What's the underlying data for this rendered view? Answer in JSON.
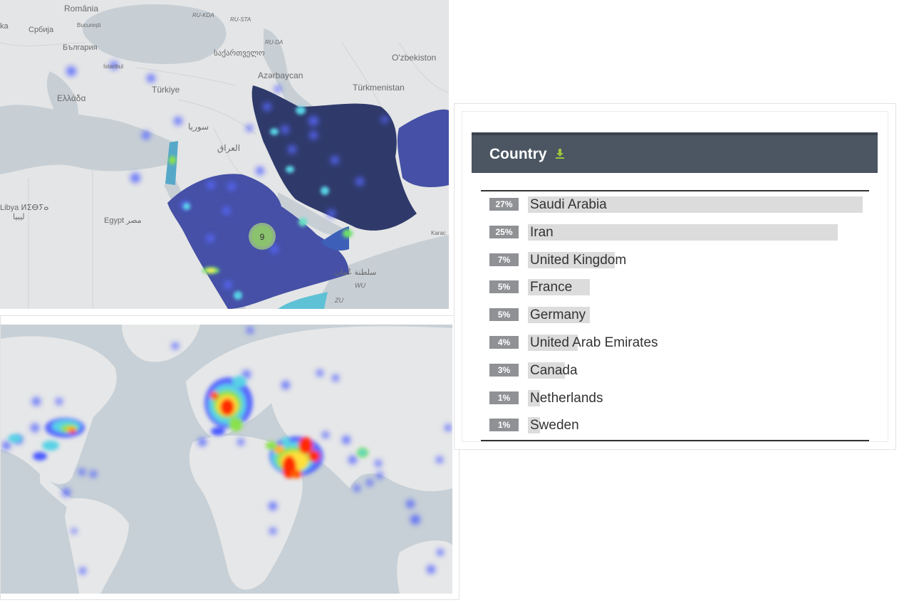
{
  "top_map": {
    "labels": {
      "romania": "România",
      "serbia": "Србија",
      "bucharest": "București",
      "bulgaria": "България",
      "istanbul": "İstanbul",
      "turkey": "Türkiye",
      "greece": "Ελλάδα",
      "georgia": "საქართველო",
      "azerbaijan": "Azərbaycan",
      "uzbekistan": "O'zbekiston",
      "turkmenistan": "Türkmenistan",
      "syria": "سوريا",
      "iraq": "العراق",
      "egypt": "Egypt مصر",
      "libya": "Libya ⵍⵉⴱⵢⴰ",
      "libya_ar": "ليبيا",
      "oman": "سلطنة عُمان",
      "ru_kda": "RU-KDA",
      "ru_sta": "RU-STA",
      "ru_da": "RU-DA",
      "wu": "WU",
      "zu": "ZU",
      "karachi": "Karac",
      "ka": "ka"
    },
    "cluster_count": "9"
  },
  "country_panel": {
    "title": "Country",
    "rows": [
      {
        "percent": "27%",
        "name": "Saudi Arabia",
        "share": 27
      },
      {
        "percent": "25%",
        "name": "Iran",
        "share": 25
      },
      {
        "percent": "7%",
        "name": "United Kingdom",
        "share": 7
      },
      {
        "percent": "5%",
        "name": "France",
        "share": 5
      },
      {
        "percent": "5%",
        "name": "Germany",
        "share": 5
      },
      {
        "percent": "4%",
        "name": "United Arab Emirates",
        "share": 4
      },
      {
        "percent": "3%",
        "name": "Canada",
        "share": 3
      },
      {
        "percent": "1%",
        "name": "Netherlands",
        "share": 1
      },
      {
        "percent": "1%",
        "name": "Sweden",
        "share": 1
      }
    ]
  },
  "colors": {
    "header_bg": "#4b5662",
    "badge_bg": "#8f9194",
    "bar_bg": "#dcdcdc",
    "download_icon": "#9bc53d",
    "choropleth_dark": "#2f3a6b",
    "choropleth_mid": "#4550a6",
    "heat_low": "#4b5cff",
    "heat_high": "#ff2a00"
  },
  "icons": {
    "download": "download-icon"
  }
}
